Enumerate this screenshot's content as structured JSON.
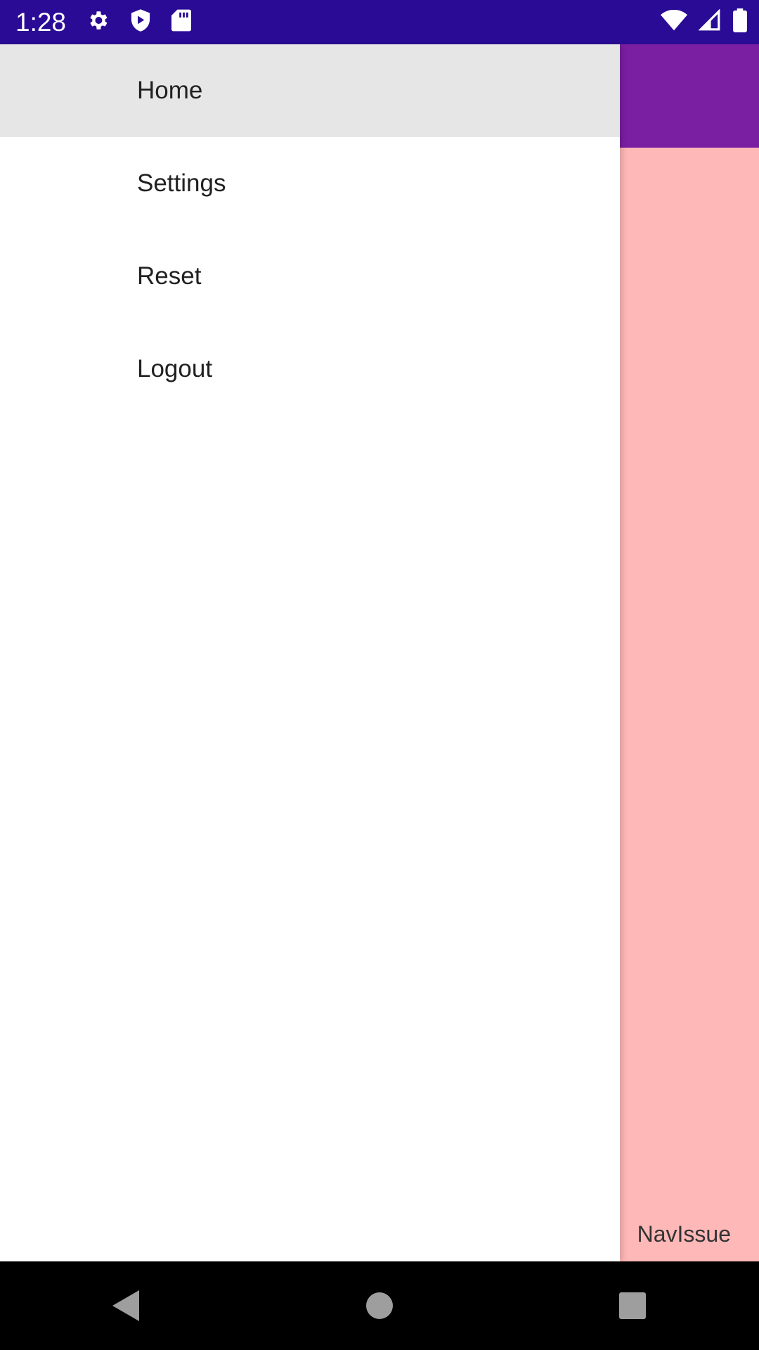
{
  "status_bar": {
    "time": "1:28",
    "left_icons": [
      "gear-icon",
      "shield-play-icon",
      "sd-card-icon"
    ],
    "right_icons": [
      "wifi-icon",
      "cell-signal-icon",
      "battery-icon"
    ],
    "background": "#2a0b96"
  },
  "app": {
    "toolbar_color": "#7b1fa2",
    "content_color": "#ffb8b8",
    "content_label": "NavIssue"
  },
  "drawer": {
    "items": [
      {
        "label": "Home",
        "selected": true
      },
      {
        "label": "Settings",
        "selected": false
      },
      {
        "label": "Reset",
        "selected": false
      },
      {
        "label": "Logout",
        "selected": false
      }
    ]
  },
  "nav_bar": {
    "buttons": [
      "back-icon",
      "home-icon",
      "recents-icon"
    ]
  }
}
